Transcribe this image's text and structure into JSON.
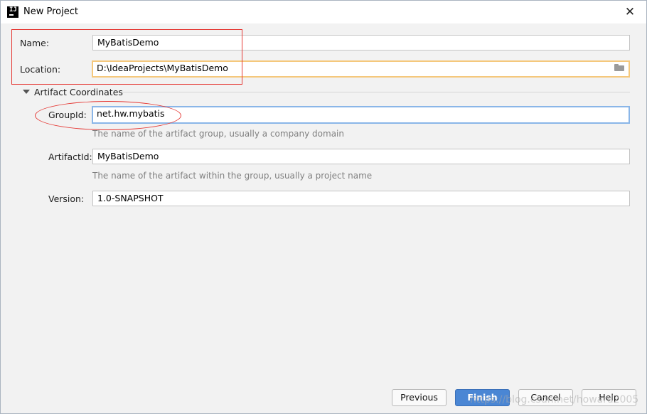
{
  "window": {
    "title": "New Project",
    "close_glyph": "✕"
  },
  "form": {
    "name": {
      "label": "Name:",
      "value": "MyBatisDemo"
    },
    "location": {
      "label": "Location:",
      "value": "D:\\IdeaProjects\\MyBatisDemo"
    },
    "section": {
      "label": "Artifact Coordinates"
    },
    "group_id": {
      "label": "GroupId:",
      "value": "net.hw.mybatis",
      "hint": "The name of the artifact group, usually a company domain"
    },
    "artifact_id": {
      "label": "ArtifactId:",
      "value": "MyBatisDemo",
      "hint": "The name of the artifact within the group, usually a project name"
    },
    "version": {
      "label": "Version:",
      "value": "1.0-SNAPSHOT"
    }
  },
  "buttons": {
    "previous": "Previous",
    "finish": "Finish",
    "cancel": "Cancel",
    "help": "Help"
  },
  "watermark": "https://blog.csdn.net/howard2005",
  "icons": {
    "app": "intellij-idea-icon",
    "folder": "folder-icon",
    "close": "close-icon",
    "collapse": "triangle-down-icon"
  },
  "colors": {
    "primary_button": "#4a86d4",
    "annotation": "#e53935",
    "focus_orange": "#f5c87c",
    "focus_blue": "#8ab6e8"
  }
}
